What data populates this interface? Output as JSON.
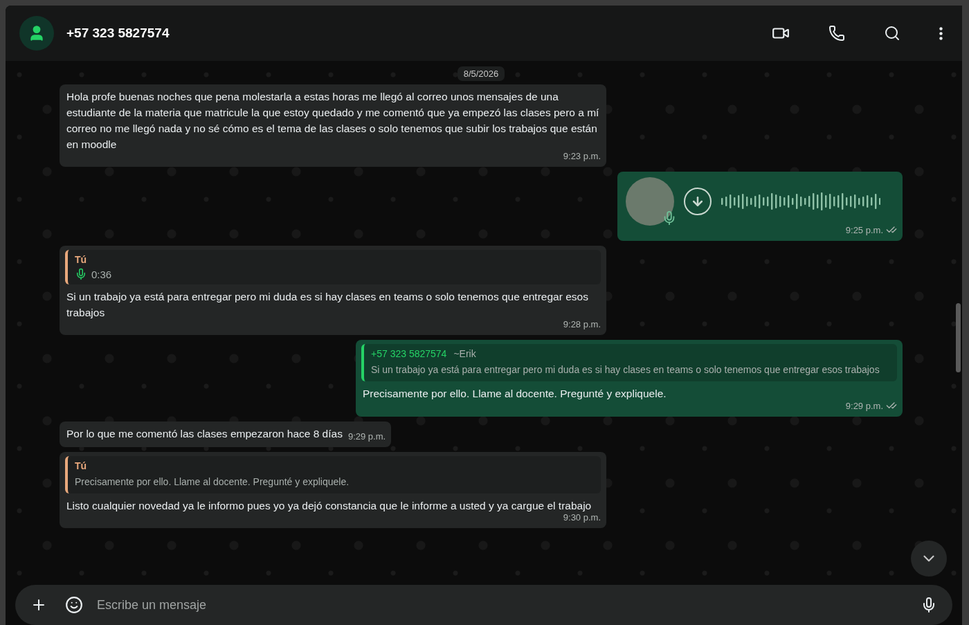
{
  "header": {
    "name": "+57 323 5827574"
  },
  "date_pill": "8/5/2026",
  "messages": [
    {
      "kind": "text",
      "outgoing": false,
      "text": "Hola profe buenas noches que pena molestarla a estas horas me llegó al correo unos mensajes de una estudiante de la materia que matricule la que estoy quedado y me comentó que ya empezó las clases pero a mí correo no me llegó nada y no sé cómo es el tema de las clases o solo tenemos que subir los trabajos que están en moodle",
      "time": "9:23 p.m."
    },
    {
      "kind": "voice",
      "outgoing": true,
      "time": "9:25 p.m.",
      "delivered": true
    },
    {
      "kind": "reply",
      "outgoing": false,
      "quote": {
        "author": "Tú",
        "color": "#e8a87c",
        "kind": "voice",
        "text": "0:36"
      },
      "text": "Si un trabajo ya está para entregar pero mi duda es si hay clases en teams o solo tenemos que entregar esos trabajos",
      "time": "9:28 p.m."
    },
    {
      "kind": "reply",
      "outgoing": true,
      "quote": {
        "author": "+57 323 5827574",
        "author_suffix": "~Erik",
        "color": "#25d366",
        "kind": "text",
        "text": "Si un trabajo ya está para entregar pero mi duda es si hay clases en teams o solo tenemos que entregar esos trabajos"
      },
      "text": "Precisamente por ello. Llame al docente. Pregunté y expliquele.",
      "time": "9:29 p.m.",
      "delivered": true
    },
    {
      "kind": "text",
      "outgoing": false,
      "text": "Por lo que me comentó las clases empezaron hace 8 días",
      "time": "9:29 p.m."
    },
    {
      "kind": "reply",
      "outgoing": false,
      "quote": {
        "author": "Tú",
        "color": "#e8a87c",
        "kind": "text",
        "text": "Precisamente por ello. Llame al docente. Pregunté y expliquele."
      },
      "text": "Listo cualquier novedad ya le informo pues yo ya dejó constancia que le informe a usted y ya cargue el trabajo",
      "time": "9:30 p.m."
    }
  ],
  "composer": {
    "placeholder": "Escribe un mensaje"
  }
}
